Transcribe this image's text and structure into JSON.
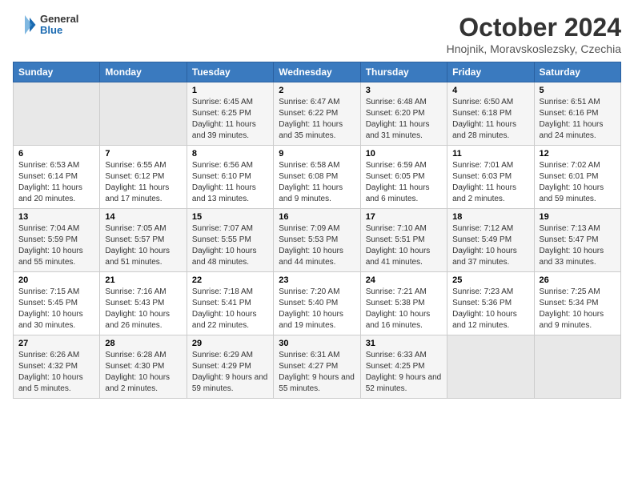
{
  "header": {
    "logo_line1": "General",
    "logo_line2": "Blue",
    "month_title": "October 2024",
    "location": "Hnojnik, Moravskoslezsky, Czechia"
  },
  "weekdays": [
    "Sunday",
    "Monday",
    "Tuesday",
    "Wednesday",
    "Thursday",
    "Friday",
    "Saturday"
  ],
  "weeks": [
    [
      {
        "day": "",
        "content": ""
      },
      {
        "day": "",
        "content": ""
      },
      {
        "day": "1",
        "content": "Sunrise: 6:45 AM\nSunset: 6:25 PM\nDaylight: 11 hours and 39 minutes."
      },
      {
        "day": "2",
        "content": "Sunrise: 6:47 AM\nSunset: 6:22 PM\nDaylight: 11 hours and 35 minutes."
      },
      {
        "day": "3",
        "content": "Sunrise: 6:48 AM\nSunset: 6:20 PM\nDaylight: 11 hours and 31 minutes."
      },
      {
        "day": "4",
        "content": "Sunrise: 6:50 AM\nSunset: 6:18 PM\nDaylight: 11 hours and 28 minutes."
      },
      {
        "day": "5",
        "content": "Sunrise: 6:51 AM\nSunset: 6:16 PM\nDaylight: 11 hours and 24 minutes."
      }
    ],
    [
      {
        "day": "6",
        "content": "Sunrise: 6:53 AM\nSunset: 6:14 PM\nDaylight: 11 hours and 20 minutes."
      },
      {
        "day": "7",
        "content": "Sunrise: 6:55 AM\nSunset: 6:12 PM\nDaylight: 11 hours and 17 minutes."
      },
      {
        "day": "8",
        "content": "Sunrise: 6:56 AM\nSunset: 6:10 PM\nDaylight: 11 hours and 13 minutes."
      },
      {
        "day": "9",
        "content": "Sunrise: 6:58 AM\nSunset: 6:08 PM\nDaylight: 11 hours and 9 minutes."
      },
      {
        "day": "10",
        "content": "Sunrise: 6:59 AM\nSunset: 6:05 PM\nDaylight: 11 hours and 6 minutes."
      },
      {
        "day": "11",
        "content": "Sunrise: 7:01 AM\nSunset: 6:03 PM\nDaylight: 11 hours and 2 minutes."
      },
      {
        "day": "12",
        "content": "Sunrise: 7:02 AM\nSunset: 6:01 PM\nDaylight: 10 hours and 59 minutes."
      }
    ],
    [
      {
        "day": "13",
        "content": "Sunrise: 7:04 AM\nSunset: 5:59 PM\nDaylight: 10 hours and 55 minutes."
      },
      {
        "day": "14",
        "content": "Sunrise: 7:05 AM\nSunset: 5:57 PM\nDaylight: 10 hours and 51 minutes."
      },
      {
        "day": "15",
        "content": "Sunrise: 7:07 AM\nSunset: 5:55 PM\nDaylight: 10 hours and 48 minutes."
      },
      {
        "day": "16",
        "content": "Sunrise: 7:09 AM\nSunset: 5:53 PM\nDaylight: 10 hours and 44 minutes."
      },
      {
        "day": "17",
        "content": "Sunrise: 7:10 AM\nSunset: 5:51 PM\nDaylight: 10 hours and 41 minutes."
      },
      {
        "day": "18",
        "content": "Sunrise: 7:12 AM\nSunset: 5:49 PM\nDaylight: 10 hours and 37 minutes."
      },
      {
        "day": "19",
        "content": "Sunrise: 7:13 AM\nSunset: 5:47 PM\nDaylight: 10 hours and 33 minutes."
      }
    ],
    [
      {
        "day": "20",
        "content": "Sunrise: 7:15 AM\nSunset: 5:45 PM\nDaylight: 10 hours and 30 minutes."
      },
      {
        "day": "21",
        "content": "Sunrise: 7:16 AM\nSunset: 5:43 PM\nDaylight: 10 hours and 26 minutes."
      },
      {
        "day": "22",
        "content": "Sunrise: 7:18 AM\nSunset: 5:41 PM\nDaylight: 10 hours and 22 minutes."
      },
      {
        "day": "23",
        "content": "Sunrise: 7:20 AM\nSunset: 5:40 PM\nDaylight: 10 hours and 19 minutes."
      },
      {
        "day": "24",
        "content": "Sunrise: 7:21 AM\nSunset: 5:38 PM\nDaylight: 10 hours and 16 minutes."
      },
      {
        "day": "25",
        "content": "Sunrise: 7:23 AM\nSunset: 5:36 PM\nDaylight: 10 hours and 12 minutes."
      },
      {
        "day": "26",
        "content": "Sunrise: 7:25 AM\nSunset: 5:34 PM\nDaylight: 10 hours and 9 minutes."
      }
    ],
    [
      {
        "day": "27",
        "content": "Sunrise: 6:26 AM\nSunset: 4:32 PM\nDaylight: 10 hours and 5 minutes."
      },
      {
        "day": "28",
        "content": "Sunrise: 6:28 AM\nSunset: 4:30 PM\nDaylight: 10 hours and 2 minutes."
      },
      {
        "day": "29",
        "content": "Sunrise: 6:29 AM\nSunset: 4:29 PM\nDaylight: 9 hours and 59 minutes."
      },
      {
        "day": "30",
        "content": "Sunrise: 6:31 AM\nSunset: 4:27 PM\nDaylight: 9 hours and 55 minutes."
      },
      {
        "day": "31",
        "content": "Sunrise: 6:33 AM\nSunset: 4:25 PM\nDaylight: 9 hours and 52 minutes."
      },
      {
        "day": "",
        "content": ""
      },
      {
        "day": "",
        "content": ""
      }
    ]
  ]
}
